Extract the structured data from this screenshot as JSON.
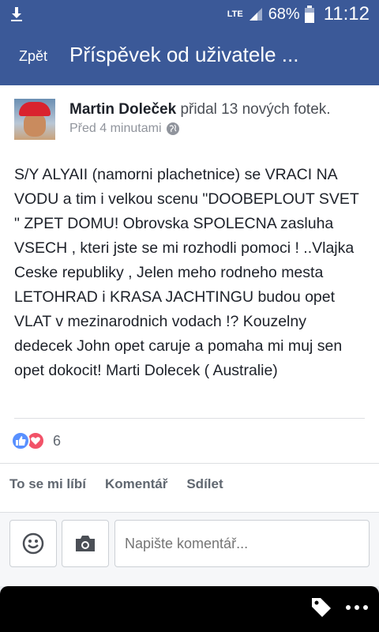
{
  "status_bar": {
    "network": "LTE",
    "battery_percent": "68%",
    "time": "11:12"
  },
  "header": {
    "back_label": "Zpět",
    "title": "Příspěvek od uživatele ..."
  },
  "post": {
    "author": "Martin Doleček",
    "action_text": "přidal 13 nových fotek.",
    "timestamp": "Před 4 minutami",
    "body": "S/Y ALYAII (namorni plachetnice) se VRACI NA VODU a tim i velkou scenu \"DOOBEPLOUT SVET \" ZPET DOMU! Obrovska SPOLECNA zasluha VSECH , kteri jste se mi rozhodli pomoci ! ..Vlajka Ceske republiky , Jelen meho rodneho mesta LETOHRAD i KRASA JACHTINGU budou opet VLAT v mezinarodnich vodach !? Kouzelny dedecek John opet caruje a pomaha mi muj sen opet dokocit! Marti Dolecek ( Australie)",
    "reaction_count": "6"
  },
  "actions": {
    "like": "To se mi líbí",
    "comment": "Komentář",
    "share": "Sdílet"
  },
  "comment_box": {
    "placeholder": "Napište komentář..."
  }
}
